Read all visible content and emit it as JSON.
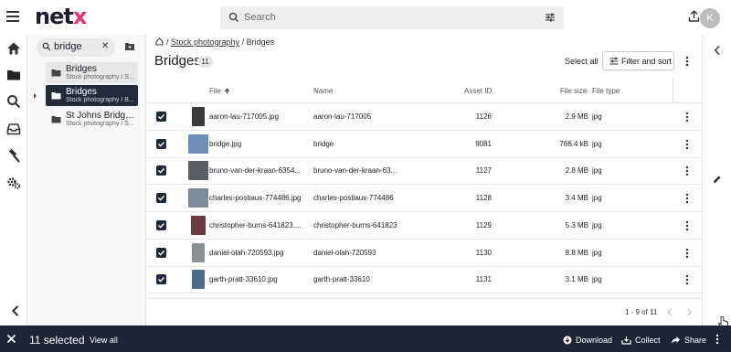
{
  "app": {
    "logo_text": "net",
    "logo_accent": "x",
    "brand_color": "#e8336d"
  },
  "search": {
    "placeholder": "Search"
  },
  "user": {
    "avatar_initial": "K"
  },
  "tree": {
    "search_value": "bridge",
    "items": [
      {
        "title": "Bridges",
        "path": "Stock photography / S...",
        "state": "hover"
      },
      {
        "title": "Bridges",
        "path": "Stock photography / B...",
        "state": "selected"
      },
      {
        "title": "St Johns Bridge ...",
        "path": "Stock photography / S...",
        "state": "normal"
      }
    ]
  },
  "breadcrumb": {
    "items": [
      "Stock photography",
      "Bridges"
    ],
    "separator": "/"
  },
  "page": {
    "title": "Bridges",
    "count": "11",
    "select_all": "Select all",
    "filter_label": "Filter and sort"
  },
  "table": {
    "columns": [
      "File",
      "Name",
      "Asset ID",
      "File size",
      "File type"
    ],
    "sort_column": "File",
    "sort_direction": "ascending",
    "rows": [
      {
        "file": "aaron-lau-717005.jpg",
        "name": "aaron-lau-717005",
        "asset_id": "1126",
        "size": "2.9 MB",
        "type": "jpg",
        "checked": true,
        "thumb_color": "#3a3a3a"
      },
      {
        "file": "bridge.jpg",
        "name": "bridge",
        "asset_id": "9081",
        "size": "766.4 kB",
        "type": "jpg",
        "checked": true,
        "thumb_color": "#6d8fb5"
      },
      {
        "file": "bruno-van-der-kraan-6354...",
        "name": "bruno-van-der-kraan-63...",
        "asset_id": "1127",
        "size": "2.8 MB",
        "type": "jpg",
        "checked": true,
        "thumb_color": "#5a5f66"
      },
      {
        "file": "charles-postiaux-774486.jpg",
        "name": "charles-postiaux-774486",
        "asset_id": "1128",
        "size": "3.4 MB",
        "type": "jpg",
        "checked": true,
        "thumb_color": "#7d8a99"
      },
      {
        "file": "christopher-burns-641823....",
        "name": "christopher-burns-641823",
        "asset_id": "1129",
        "size": "5.3 MB",
        "type": "jpg",
        "checked": true,
        "thumb_color": "#6b3b3b"
      },
      {
        "file": "daniel-olah-720593.jpg",
        "name": "daniel-olah-720593",
        "asset_id": "1130",
        "size": "8.8 MB",
        "type": "jpg",
        "checked": true,
        "thumb_color": "#8a8f96"
      },
      {
        "file": "garth-pratt-33610.jpg",
        "name": "garth-pratt-33610",
        "asset_id": "1131",
        "size": "3.1 MB",
        "type": "jpg",
        "checked": true,
        "thumb_color": "#4d6a8f"
      }
    ]
  },
  "pagination": {
    "text": "1 - 9 of 11"
  },
  "selection_bar": {
    "count_text": "11 selected",
    "view_all": "View all",
    "download": "Download",
    "collect": "Collect",
    "share": "Share"
  },
  "icons": {
    "menu": "hamburger-icon",
    "search": "search-icon",
    "tune": "tune-icon",
    "upload": "upload-icon",
    "home": "home-icon",
    "folder": "folder-icon",
    "inbox": "inbox-icon",
    "hammer": "hammer-icon",
    "settings": "settings-icon"
  }
}
